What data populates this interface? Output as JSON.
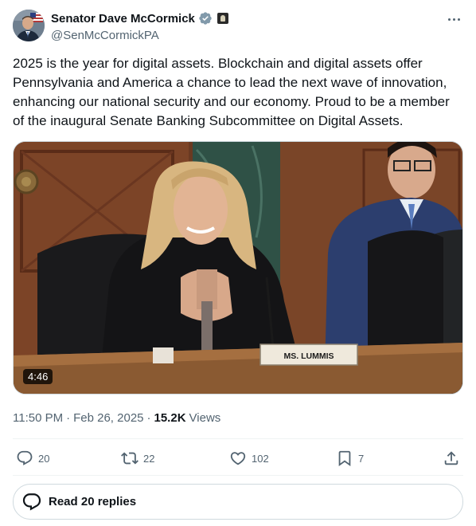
{
  "author": {
    "display_name": "Senator Dave McCormick",
    "handle": "@SenMcCormickPA"
  },
  "icons": {
    "verified": "verified-badge-icon",
    "government": "government-affiliation-icon",
    "more": "more-options-icon",
    "reply": "reply-icon",
    "retweet": "retweet-icon",
    "like": "like-icon",
    "bookmark": "bookmark-icon",
    "share": "share-icon",
    "replies": "replies-bubble-icon"
  },
  "tweet": {
    "text": "2025 is the year for digital assets. Blockchain and digital assets offer\nPennsylvania and America a chance to lead the next wave of innovation,\nenhancing our national security and our economy. Proud to be a member\nof the inaugural Senate Banking Subcommittee on Digital Assets."
  },
  "media": {
    "duration": "4:46",
    "nameplate": "MS. LUMMIS"
  },
  "meta": {
    "time": "11:50 PM",
    "separator": "·",
    "date": "Feb 26, 2025",
    "views_count": "15.2K",
    "views_label": "Views"
  },
  "actions": {
    "replies": "20",
    "retweets": "22",
    "likes": "102",
    "bookmarks": "7"
  },
  "read_replies_label": "Read 20 replies",
  "colors": {
    "text_primary": "#0f1419",
    "text_secondary": "#536471",
    "verified_blue": "#829aab",
    "border": "#cfd9de"
  }
}
